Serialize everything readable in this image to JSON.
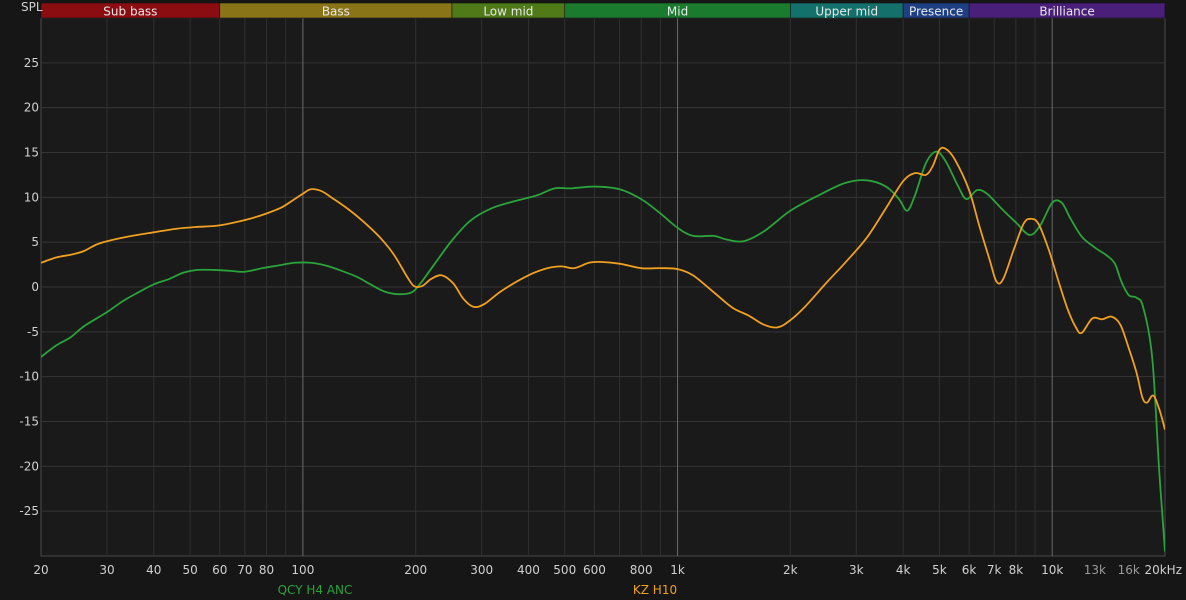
{
  "chart_data": {
    "type": "line",
    "ylabel": "SPL",
    "x_scale": "log",
    "xlim": [
      20,
      20000
    ],
    "ylim": [
      -30,
      30
    ],
    "grid": true,
    "legend_position": "bottom",
    "bands": [
      {
        "label": "Sub bass",
        "from": 20,
        "to": 60,
        "color": "#8b0d12"
      },
      {
        "label": "Bass",
        "from": 60,
        "to": 250,
        "color": "#8a7418"
      },
      {
        "label": "Low mid",
        "from": 250,
        "to": 500,
        "color": "#4f7a17"
      },
      {
        "label": "Mid",
        "from": 500,
        "to": 2000,
        "color": "#1a7a2e"
      },
      {
        "label": "Upper mid",
        "from": 2000,
        "to": 4000,
        "color": "#13706a"
      },
      {
        "label": "Presence",
        "from": 4000,
        "to": 6000,
        "color": "#1f3f85"
      },
      {
        "label": "Brilliance",
        "from": 6000,
        "to": 20000,
        "color": "#4a1f7a"
      }
    ],
    "y_ticks": [
      25,
      20,
      15,
      10,
      5,
      0,
      -5,
      -10,
      -15,
      -20,
      -25
    ],
    "x_ticks": [
      {
        "value": 20,
        "label": "20"
      },
      {
        "value": 30,
        "label": "30"
      },
      {
        "value": 40,
        "label": "40"
      },
      {
        "value": 50,
        "label": "50"
      },
      {
        "value": 60,
        "label": "60"
      },
      {
        "value": 70,
        "label": "70"
      },
      {
        "value": 80,
        "label": "80"
      },
      {
        "value": 100,
        "label": "100"
      },
      {
        "value": 200,
        "label": "200"
      },
      {
        "value": 300,
        "label": "300"
      },
      {
        "value": 400,
        "label": "400"
      },
      {
        "value": 500,
        "label": "500"
      },
      {
        "value": 600,
        "label": "600"
      },
      {
        "value": 800,
        "label": "800"
      },
      {
        "value": 1000,
        "label": "1k"
      },
      {
        "value": 2000,
        "label": "2k"
      },
      {
        "value": 3000,
        "label": "3k"
      },
      {
        "value": 4000,
        "label": "4k"
      },
      {
        "value": 5000,
        "label": "5k"
      },
      {
        "value": 6000,
        "label": "6k"
      },
      {
        "value": 7000,
        "label": "7k"
      },
      {
        "value": 8000,
        "label": "8k"
      },
      {
        "value": 10000,
        "label": "10k"
      },
      {
        "value": 13000,
        "label": "13k",
        "dim": true
      },
      {
        "value": 16000,
        "label": "16k",
        "dim": true
      },
      {
        "value": 20000,
        "label": "20kHz"
      }
    ],
    "series": [
      {
        "name": "QCY H4 ANC",
        "color": "#2aa33a",
        "points": [
          [
            20,
            -7.8
          ],
          [
            22,
            -6.5
          ],
          [
            24,
            -5.6
          ],
          [
            26,
            -4.4
          ],
          [
            30,
            -2.8
          ],
          [
            33,
            -1.6
          ],
          [
            36,
            -0.7
          ],
          [
            40,
            0.3
          ],
          [
            44,
            0.9
          ],
          [
            48,
            1.6
          ],
          [
            52,
            1.9
          ],
          [
            58,
            1.9
          ],
          [
            64,
            1.8
          ],
          [
            70,
            1.7
          ],
          [
            78,
            2.1
          ],
          [
            86,
            2.4
          ],
          [
            95,
            2.7
          ],
          [
            105,
            2.7
          ],
          [
            115,
            2.4
          ],
          [
            125,
            1.9
          ],
          [
            140,
            1.1
          ],
          [
            150,
            0.4
          ],
          [
            165,
            -0.5
          ],
          [
            180,
            -0.8
          ],
          [
            195,
            -0.6
          ],
          [
            205,
            0.3
          ],
          [
            225,
            2.6
          ],
          [
            250,
            5.2
          ],
          [
            280,
            7.4
          ],
          [
            320,
            8.8
          ],
          [
            370,
            9.6
          ],
          [
            420,
            10.2
          ],
          [
            470,
            11.0
          ],
          [
            520,
            11.0
          ],
          [
            600,
            11.2
          ],
          [
            700,
            10.9
          ],
          [
            800,
            9.8
          ],
          [
            900,
            8.2
          ],
          [
            1000,
            6.6
          ],
          [
            1100,
            5.7
          ],
          [
            1250,
            5.7
          ],
          [
            1350,
            5.3
          ],
          [
            1500,
            5.1
          ],
          [
            1700,
            6.2
          ],
          [
            2000,
            8.5
          ],
          [
            2400,
            10.3
          ],
          [
            2800,
            11.6
          ],
          [
            3200,
            11.9
          ],
          [
            3600,
            11.2
          ],
          [
            3900,
            9.8
          ],
          [
            4100,
            8.5
          ],
          [
            4300,
            10.2
          ],
          [
            4600,
            13.8
          ],
          [
            4900,
            15.1
          ],
          [
            5200,
            14.0
          ],
          [
            5600,
            11.3
          ],
          [
            5900,
            9.8
          ],
          [
            6300,
            10.8
          ],
          [
            6700,
            10.4
          ],
          [
            7300,
            8.8
          ],
          [
            8000,
            7.2
          ],
          [
            8700,
            5.8
          ],
          [
            9300,
            6.9
          ],
          [
            10000,
            9.4
          ],
          [
            10600,
            9.4
          ],
          [
            11200,
            7.6
          ],
          [
            12000,
            5.6
          ],
          [
            13000,
            4.4
          ],
          [
            14000,
            3.5
          ],
          [
            14700,
            2.6
          ],
          [
            15300,
            0.6
          ],
          [
            16000,
            -0.9
          ],
          [
            16800,
            -1.2
          ],
          [
            17500,
            -2.3
          ],
          [
            18500,
            -8.0
          ],
          [
            19300,
            -20.5
          ],
          [
            20000,
            -29.5
          ]
        ]
      },
      {
        "name": "KZ H10",
        "color": "#f0a020",
        "points": [
          [
            20,
            2.7
          ],
          [
            22,
            3.3
          ],
          [
            24,
            3.6
          ],
          [
            26,
            4.0
          ],
          [
            28,
            4.7
          ],
          [
            30,
            5.1
          ],
          [
            34,
            5.6
          ],
          [
            40,
            6.1
          ],
          [
            46,
            6.5
          ],
          [
            52,
            6.7
          ],
          [
            58,
            6.8
          ],
          [
            64,
            7.1
          ],
          [
            72,
            7.6
          ],
          [
            80,
            8.2
          ],
          [
            88,
            8.9
          ],
          [
            95,
            9.8
          ],
          [
            100,
            10.4
          ],
          [
            105,
            10.9
          ],
          [
            112,
            10.7
          ],
          [
            120,
            9.9
          ],
          [
            132,
            8.7
          ],
          [
            145,
            7.3
          ],
          [
            160,
            5.6
          ],
          [
            175,
            3.6
          ],
          [
            190,
            1.1
          ],
          [
            198,
            0.1
          ],
          [
            208,
            0.1
          ],
          [
            220,
            0.9
          ],
          [
            235,
            1.3
          ],
          [
            252,
            0.4
          ],
          [
            268,
            -1.3
          ],
          [
            285,
            -2.2
          ],
          [
            305,
            -1.9
          ],
          [
            340,
            -0.4
          ],
          [
            400,
            1.3
          ],
          [
            450,
            2.1
          ],
          [
            490,
            2.3
          ],
          [
            530,
            2.1
          ],
          [
            580,
            2.7
          ],
          [
            620,
            2.8
          ],
          [
            700,
            2.6
          ],
          [
            800,
            2.1
          ],
          [
            900,
            2.1
          ],
          [
            1000,
            2.0
          ],
          [
            1100,
            1.3
          ],
          [
            1250,
            -0.6
          ],
          [
            1400,
            -2.3
          ],
          [
            1550,
            -3.2
          ],
          [
            1700,
            -4.2
          ],
          [
            1850,
            -4.5
          ],
          [
            2000,
            -3.7
          ],
          [
            2200,
            -2.1
          ],
          [
            2500,
            0.5
          ],
          [
            2800,
            2.7
          ],
          [
            3200,
            5.5
          ],
          [
            3600,
            8.8
          ],
          [
            4000,
            11.8
          ],
          [
            4300,
            12.7
          ],
          [
            4600,
            12.5
          ],
          [
            4800,
            13.5
          ],
          [
            5000,
            15.3
          ],
          [
            5200,
            15.4
          ],
          [
            5500,
            14.2
          ],
          [
            6000,
            10.8
          ],
          [
            6400,
            6.7
          ],
          [
            6800,
            3.1
          ],
          [
            7100,
            0.6
          ],
          [
            7400,
            0.9
          ],
          [
            7900,
            4.2
          ],
          [
            8400,
            7.1
          ],
          [
            8800,
            7.6
          ],
          [
            9200,
            7.0
          ],
          [
            9800,
            4.1
          ],
          [
            10400,
            0.6
          ],
          [
            11000,
            -2.5
          ],
          [
            11600,
            -4.6
          ],
          [
            12000,
            -5.1
          ],
          [
            12800,
            -3.5
          ],
          [
            13600,
            -3.6
          ],
          [
            14400,
            -3.3
          ],
          [
            15200,
            -4.2
          ],
          [
            16000,
            -6.8
          ],
          [
            16800,
            -9.6
          ],
          [
            17400,
            -12.3
          ],
          [
            17900,
            -12.9
          ],
          [
            18600,
            -12.1
          ],
          [
            19300,
            -13.6
          ],
          [
            20000,
            -15.9
          ]
        ]
      }
    ]
  }
}
